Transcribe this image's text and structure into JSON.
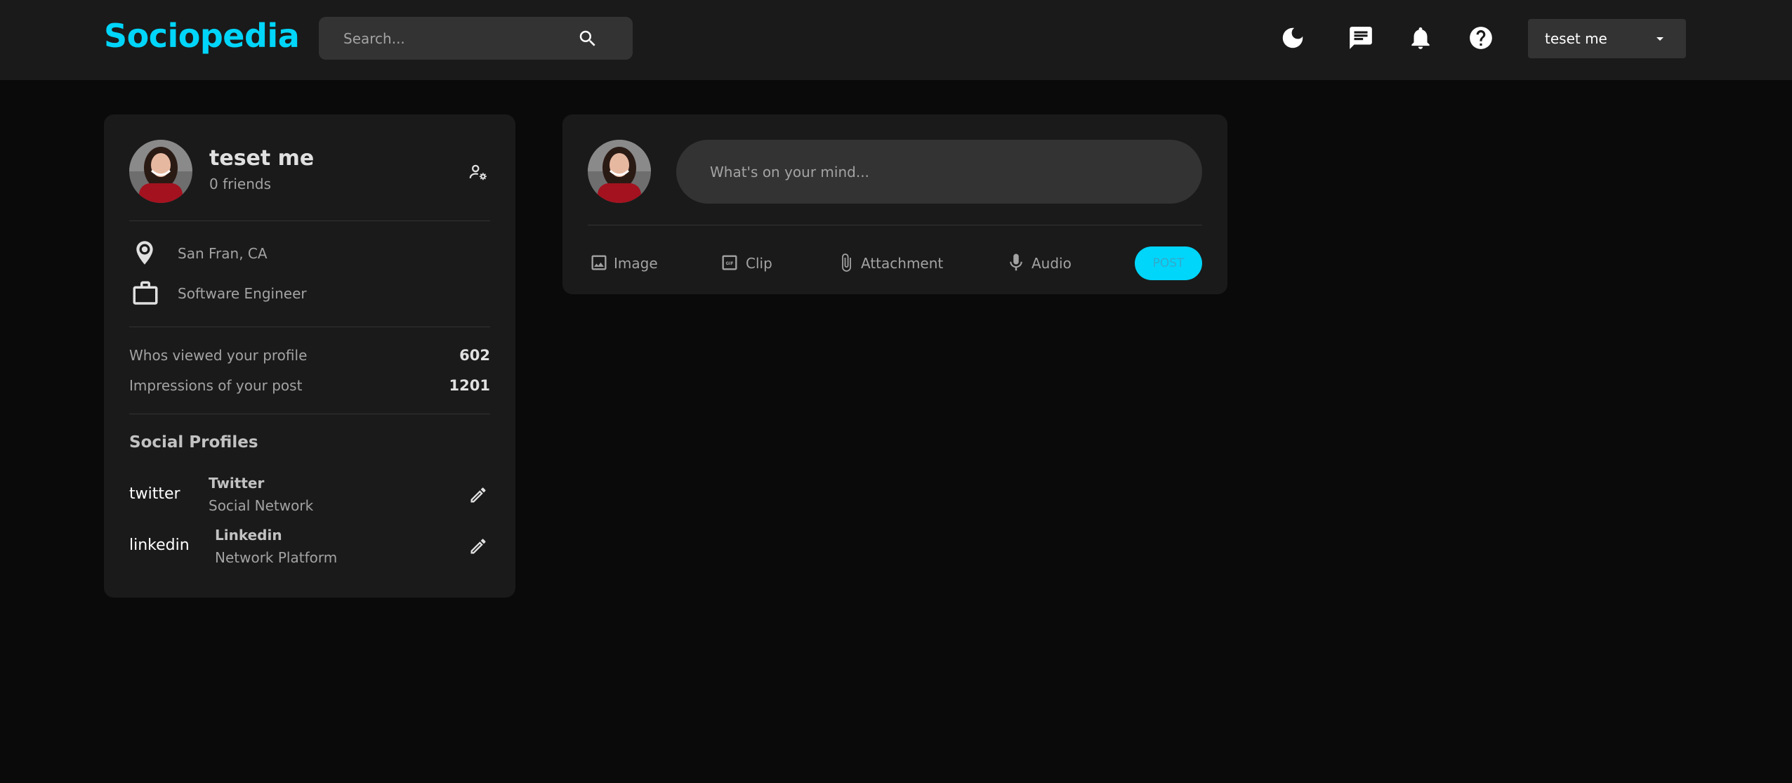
{
  "header": {
    "logo": "Sociopedia",
    "search_placeholder": "Search...",
    "user_name": "teset me"
  },
  "icons": {
    "search": "search-icon",
    "theme": "dark-mode-icon",
    "messages": "message-icon",
    "notifications": "notifications-icon",
    "help": "help-icon",
    "dropdown": "arrow-drop-down-icon"
  },
  "user_card": {
    "name": "teset me",
    "friends": "0 friends",
    "location": "San Fran, CA",
    "occupation": "Software Engineer",
    "stats": [
      {
        "label": "Whos viewed your profile",
        "value": "602"
      },
      {
        "label": "Impressions of your post",
        "value": "1201"
      }
    ],
    "social_title": "Social Profiles",
    "social": [
      {
        "alt": "twitter",
        "name": "Twitter",
        "type": "Social Network"
      },
      {
        "alt": "linkedin",
        "name": "Linkedin",
        "type": "Network Platform"
      }
    ]
  },
  "post_composer": {
    "placeholder": "What's on your mind...",
    "actions": [
      "Image",
      "Clip",
      "Attachment",
      "Audio"
    ],
    "post_label": "POST"
  },
  "colors": {
    "brand": "#00d5fa",
    "background": "#0a0a0a",
    "surface": "#1a1a1a",
    "input": "#333333"
  }
}
